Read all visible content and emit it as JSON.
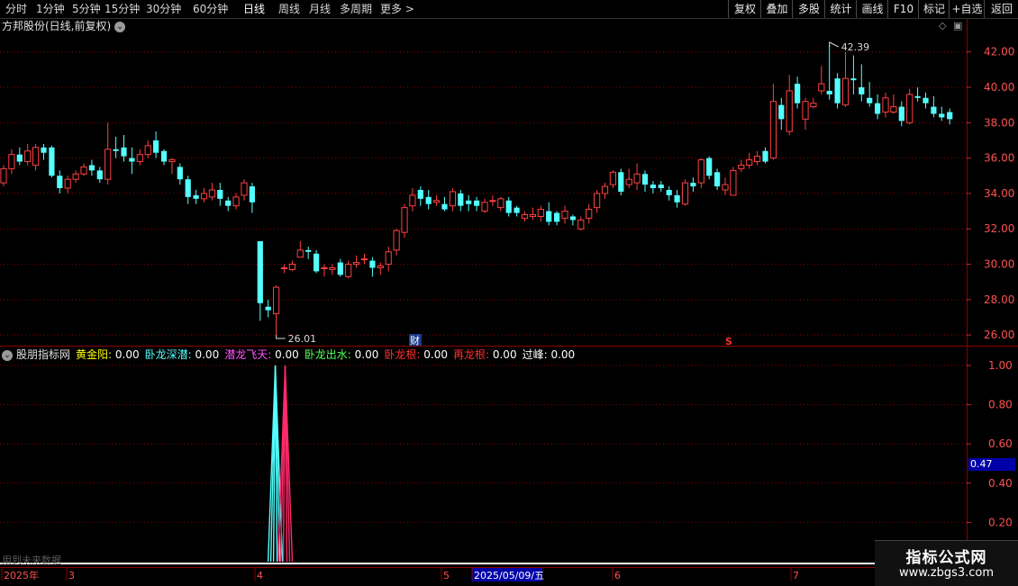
{
  "toolbar": {
    "left": [
      "分时",
      "1分钟",
      "5分钟",
      "15分钟",
      "30分钟",
      "60分钟",
      "日线",
      "周线",
      "月线",
      "多周期",
      "更多 >"
    ],
    "active": "日线",
    "right": [
      "复权",
      "叠加",
      "多股",
      "统计",
      "画线",
      "F10",
      "标记",
      "+自选",
      "返回"
    ]
  },
  "chart": {
    "title": "方邦股份(日线,前复权)",
    "high_label": "42.39",
    "low_label": "26.01",
    "fin_marker": "财",
    "s_marker": "S",
    "yticks": [
      "42.00",
      "40.00",
      "38.00",
      "36.00",
      "34.00",
      "32.00",
      "30.00",
      "28.00",
      "26.00"
    ]
  },
  "indicator": {
    "name": "股朋指标网",
    "items": [
      {
        "label": "黄金阳",
        "value": "0.00",
        "color": "#ffff00"
      },
      {
        "label": "卧龙深潜",
        "value": "0.00",
        "color": "#55ffff"
      },
      {
        "label": "潜龙飞天",
        "value": "0.00",
        "color": "#ff55ff"
      },
      {
        "label": "卧龙出水",
        "value": "0.00",
        "color": "#55ff55"
      },
      {
        "label": "卧龙根",
        "value": "0.00",
        "color": "#ff3030"
      },
      {
        "label": "再龙根",
        "value": "0.00",
        "color": "#ff3030"
      },
      {
        "label": "过峰",
        "value": "0.00",
        "color": "#ffffff"
      }
    ],
    "yticks": [
      "1.00",
      "0.80",
      "0.60",
      "0.40",
      "0.20"
    ],
    "current": "0.47",
    "current_value": 0.47
  },
  "axis": {
    "labels": [
      "2025年",
      "3",
      "4",
      "5",
      "2025/05/09/五",
      "6",
      "7"
    ]
  },
  "future_note": "用到未来数据",
  "watermark": {
    "line1": "指标公式网",
    "line2": "www.zbgs3.com"
  },
  "colors": {
    "up": "#ff4040",
    "down": "#54ffff",
    "grid": "#8b0000",
    "axis_text": "#ff5050"
  },
  "chart_data": {
    "type": "candlestick",
    "title": "方邦股份(日线,前复权)",
    "ylim": [
      25.5,
      43.0
    ],
    "yticks": [
      42,
      40,
      38,
      36,
      34,
      32,
      30,
      28,
      26
    ],
    "high": 42.39,
    "low": 26.01,
    "candles": [
      [
        34.6,
        35.4,
        35.6,
        34.4
      ],
      [
        35.4,
        36.2,
        36.5,
        35.1
      ],
      [
        36.2,
        35.8,
        36.6,
        35.6
      ],
      [
        35.8,
        36.4,
        36.8,
        35.6
      ],
      [
        35.6,
        36.6,
        36.8,
        35.3
      ],
      [
        36.6,
        36.3,
        36.8,
        35.9
      ],
      [
        36.6,
        35.0,
        36.7,
        34.9
      ],
      [
        35.0,
        34.3,
        35.3,
        34.0
      ],
      [
        34.3,
        34.8,
        35.0,
        34.0
      ],
      [
        34.8,
        35.1,
        35.3,
        34.6
      ],
      [
        35.1,
        35.5,
        35.7,
        35.0
      ],
      [
        35.6,
        35.3,
        35.9,
        35.0
      ],
      [
        35.3,
        34.8,
        35.5,
        34.6
      ],
      [
        34.8,
        36.5,
        38.0,
        34.5
      ],
      [
        36.5,
        36.4,
        37.2,
        36.0
      ],
      [
        36.6,
        36.1,
        37.3,
        35.8
      ],
      [
        36.0,
        35.8,
        36.6,
        35.1
      ],
      [
        35.8,
        36.2,
        36.5,
        35.6
      ],
      [
        36.2,
        36.7,
        37.0,
        36.0
      ],
      [
        37.0,
        36.3,
        37.5,
        36.0
      ],
      [
        36.4,
        35.8,
        36.5,
        35.6
      ],
      [
        35.8,
        35.9,
        36.0,
        35.1
      ],
      [
        35.5,
        34.8,
        35.7,
        34.5
      ],
      [
        34.8,
        33.8,
        35.0,
        33.4
      ],
      [
        33.9,
        33.7,
        34.2,
        33.4
      ],
      [
        33.7,
        34.0,
        34.3,
        33.5
      ],
      [
        33.8,
        34.2,
        34.6,
        33.6
      ],
      [
        34.2,
        33.7,
        34.6,
        33.3
      ],
      [
        33.6,
        33.3,
        33.8,
        33.0
      ],
      [
        33.3,
        33.8,
        34.0,
        33.1
      ],
      [
        33.9,
        34.6,
        34.8,
        33.6
      ],
      [
        34.4,
        33.5,
        34.6,
        32.9
      ],
      [
        31.3,
        27.8,
        31.3,
        26.8
      ],
      [
        27.6,
        27.4,
        28.0,
        27.0
      ],
      [
        27.2,
        28.7,
        28.8,
        26.0
      ],
      [
        29.8,
        29.8,
        30.0,
        29.5
      ],
      [
        29.7,
        30.0,
        30.2,
        29.6
      ],
      [
        30.4,
        30.8,
        31.3,
        30.4
      ],
      [
        30.8,
        30.7,
        31.0,
        30.3
      ],
      [
        30.6,
        29.6,
        30.8,
        29.5
      ],
      [
        29.8,
        29.8,
        30.0,
        29.3
      ],
      [
        29.7,
        29.8,
        30.0,
        29.4
      ],
      [
        30.1,
        29.4,
        30.3,
        29.3
      ],
      [
        29.3,
        30.0,
        30.2,
        29.2
      ],
      [
        30.0,
        30.1,
        30.5,
        29.8
      ],
      [
        30.3,
        30.3,
        30.6,
        30.0
      ],
      [
        30.2,
        29.8,
        30.4,
        29.3
      ],
      [
        29.8,
        29.9,
        30.1,
        29.4
      ],
      [
        30.0,
        30.7,
        31.0,
        29.6
      ],
      [
        30.8,
        31.9,
        32.0,
        30.5
      ],
      [
        31.8,
        33.2,
        33.4,
        31.5
      ],
      [
        33.3,
        33.9,
        34.3,
        33.0
      ],
      [
        34.2,
        33.7,
        34.4,
        33.3
      ],
      [
        33.8,
        33.4,
        34.2,
        33.1
      ],
      [
        33.5,
        33.6,
        33.9,
        33.3
      ],
      [
        33.4,
        33.1,
        33.8,
        33.0
      ],
      [
        33.3,
        34.1,
        34.3,
        33.0
      ],
      [
        34.0,
        33.3,
        34.2,
        33.0
      ],
      [
        33.6,
        33.4,
        33.9,
        33.0
      ],
      [
        33.6,
        33.3,
        33.8,
        33.0
      ],
      [
        33.0,
        33.5,
        33.7,
        32.9
      ],
      [
        33.6,
        33.6,
        33.9,
        33.3
      ],
      [
        33.2,
        33.7,
        33.8,
        33.0
      ],
      [
        33.6,
        32.9,
        33.8,
        32.7
      ],
      [
        33.2,
        32.9,
        33.3,
        32.7
      ],
      [
        32.6,
        32.8,
        33.0,
        32.4
      ],
      [
        32.7,
        32.8,
        33.2,
        32.5
      ],
      [
        32.7,
        33.1,
        33.3,
        32.4
      ],
      [
        33.0,
        32.4,
        33.5,
        32.2
      ],
      [
        32.9,
        32.4,
        33.0,
        32.2
      ],
      [
        32.6,
        33.0,
        33.3,
        32.3
      ],
      [
        32.7,
        32.5,
        32.8,
        32.2
      ],
      [
        32.0,
        32.5,
        32.7,
        31.9
      ],
      [
        32.6,
        33.1,
        33.4,
        32.3
      ],
      [
        33.2,
        34.0,
        34.2,
        32.9
      ],
      [
        34.0,
        34.4,
        34.6,
        33.7
      ],
      [
        34.5,
        35.2,
        35.3,
        34.3
      ],
      [
        35.2,
        34.1,
        35.4,
        33.9
      ],
      [
        34.5,
        34.8,
        35.4,
        34.3
      ],
      [
        34.6,
        35.1,
        35.7,
        34.2
      ],
      [
        35.1,
        34.5,
        35.3,
        34.1
      ],
      [
        34.5,
        34.3,
        34.7,
        34.0
      ],
      [
        34.5,
        34.3,
        34.7,
        34.1
      ],
      [
        34.2,
        33.9,
        34.4,
        33.6
      ],
      [
        33.9,
        33.5,
        34.2,
        33.2
      ],
      [
        33.4,
        34.6,
        34.8,
        33.3
      ],
      [
        34.6,
        34.4,
        34.9,
        34.1
      ],
      [
        34.6,
        35.9,
        36.0,
        34.3
      ],
      [
        36.0,
        35.0,
        36.1,
        34.8
      ],
      [
        35.2,
        34.4,
        35.4,
        34.2
      ],
      [
        34.2,
        34.5,
        34.9,
        33.9
      ],
      [
        33.9,
        35.3,
        35.5,
        33.9
      ],
      [
        35.4,
        35.6,
        35.9,
        35.2
      ],
      [
        35.6,
        35.9,
        36.3,
        35.4
      ],
      [
        35.8,
        36.1,
        36.4,
        35.6
      ],
      [
        36.4,
        35.8,
        36.6,
        35.7
      ],
      [
        36.0,
        39.2,
        40.2,
        35.9
      ],
      [
        39.0,
        38.2,
        39.4,
        37.6
      ],
      [
        37.5,
        39.8,
        40.7,
        37.3
      ],
      [
        40.2,
        39.1,
        40.6,
        38.8
      ],
      [
        38.2,
        39.2,
        39.4,
        37.6
      ],
      [
        38.9,
        39.1,
        39.4,
        38.8
      ],
      [
        39.8,
        40.2,
        41.2,
        39.6
      ],
      [
        39.8,
        39.6,
        42.4,
        39.3
      ],
      [
        40.5,
        39.1,
        40.8,
        38.8
      ],
      [
        39.0,
        40.5,
        42.0,
        38.9
      ],
      [
        40.5,
        40.4,
        41.8,
        39.6
      ],
      [
        40.0,
        39.6,
        41.3,
        39.2
      ],
      [
        39.4,
        39.1,
        40.3,
        38.9
      ],
      [
        39.1,
        38.5,
        39.6,
        38.2
      ],
      [
        38.6,
        39.4,
        39.7,
        38.3
      ],
      [
        38.6,
        38.9,
        39.6,
        38.5
      ],
      [
        38.9,
        38.1,
        39.2,
        37.8
      ],
      [
        38.0,
        39.6,
        39.9,
        37.9
      ],
      [
        39.5,
        39.4,
        40.0,
        39.2
      ],
      [
        39.4,
        39.1,
        39.7,
        38.8
      ],
      [
        38.9,
        38.5,
        39.5,
        38.3
      ],
      [
        38.5,
        38.3,
        38.9,
        38.1
      ],
      [
        38.6,
        38.2,
        38.8,
        37.9
      ]
    ],
    "indicator_lines": [
      {
        "name": "卧龙深潜",
        "color": "#55ffff",
        "peak_index": 34,
        "peak_value": 1.0
      },
      {
        "name": "再龙根",
        "color": "#ff2a6a",
        "peak_index": 35,
        "peak_value": 1.0
      }
    ],
    "indicator_ylim": [
      0,
      1.05
    ],
    "indicator_yticks": [
      1.0,
      0.8,
      0.6,
      0.4,
      0.2
    ]
  }
}
